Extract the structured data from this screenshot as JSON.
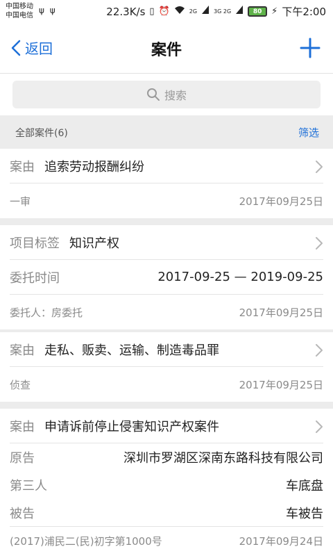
{
  "statusbar": {
    "carrier1": "中国移动",
    "carrier2": "中国电信",
    "usb": "ψ ψ",
    "speed": "22.3K/s",
    "net1": "2G",
    "net2": "3G 2G",
    "battery": "80",
    "time": "下午2:00"
  },
  "nav": {
    "back_label": "返回",
    "title": "案件"
  },
  "search": {
    "placeholder": "搜索"
  },
  "filter": {
    "count_label": "全部案件(6)",
    "filter_label": "筛选"
  },
  "cards": [
    {
      "title_label": "案由",
      "title_value": "追索劳动报酬纠纷",
      "meta": "一审",
      "date": "2017年09月25日"
    },
    {
      "title_label": "项目标签",
      "title_value": "知识产权",
      "period_label": "委托时间",
      "period_value": "2017-09-25 — 2019-09-25",
      "meta": "委托人：房委托",
      "date": "2017年09月25日"
    },
    {
      "title_label": "案由",
      "title_value": "走私、贩卖、运输、制造毒品罪",
      "meta": "侦查",
      "date": "2017年09月25日"
    },
    {
      "title_label": "案由",
      "title_value": "申请诉前停止侵害知识产权案件",
      "plaintiff_label": "原告",
      "plaintiff_value": "深圳市罗湖区深南东路科技有限公司",
      "third_label": "第三人",
      "third_value": "车底盘",
      "defendant_label": "被告",
      "defendant_value": "车被告",
      "meta": "(2017)浦民二(民)初字第1000号",
      "date": "2017年09月24日"
    }
  ]
}
